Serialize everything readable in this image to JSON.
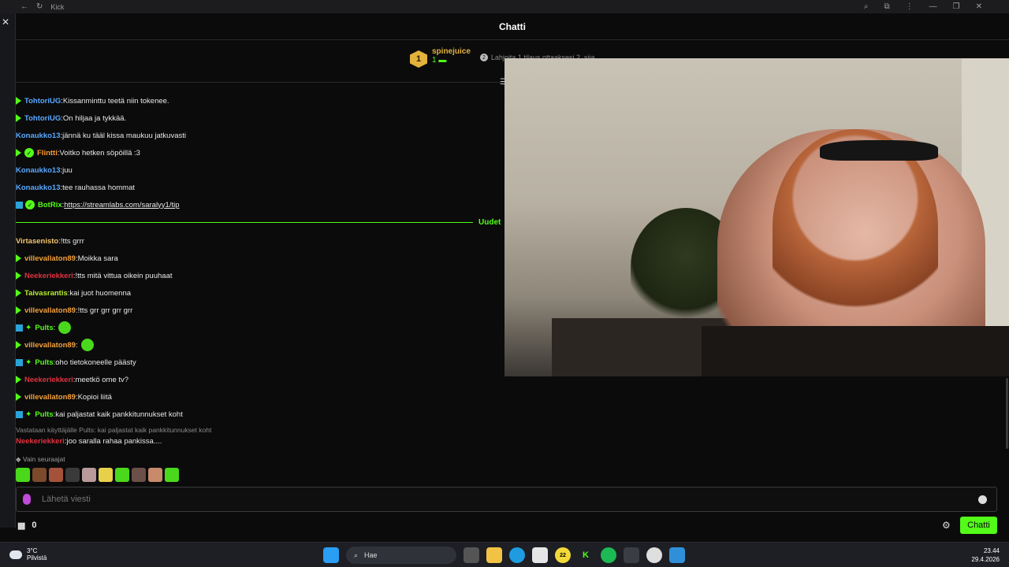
{
  "browser": {
    "title": "Kick"
  },
  "chat": {
    "header_title": "Chatti",
    "pinned": {
      "rank": "1",
      "user": "spinejuice",
      "count": "1",
      "gift_text": "Lahjoita 1 tilaus ottaaksesi 2. sija"
    },
    "new_label": "Uudet",
    "messages": [
      {
        "user": "TohtoriUG",
        "color": "#5aa9ff",
        "badge": "tri",
        "text": "Kissanminttu teetä niin tokenee."
      },
      {
        "user": "TohtoriUG",
        "color": "#5aa9ff",
        "badge": "tri",
        "text": "On hiljaa ja tykkää."
      },
      {
        "user": "Konaukko13",
        "color": "#5aa9ff",
        "badge": "",
        "text": "jännä ku tääl kissa maukuu jatkuvasti"
      },
      {
        "user": "Flintti",
        "color": "#ff9a2e",
        "badge": "tri-verify",
        "text": "Voitko hetken söpöillä :3"
      },
      {
        "user": "Konaukko13",
        "color": "#5aa9ff",
        "badge": "",
        "text": "juu"
      },
      {
        "user": "Konaukko13",
        "color": "#5aa9ff",
        "badge": "",
        "text": "tee rauhassa hommat"
      },
      {
        "user": "BotRix",
        "color": "#53fc18",
        "badge": "sq-verify",
        "text": "https://streamlabs.com/saralyy1/tip",
        "link": true
      },
      {
        "user": "Virtasenisto",
        "color": "#f4c46b",
        "badge": "",
        "text": "!tts grrr"
      },
      {
        "user": "villevallaton89",
        "color": "#f4a13b",
        "badge": "tri",
        "text": "Moikka sara"
      },
      {
        "user": "Neekeriekkeri",
        "color": "#e0323f",
        "badge": "tri",
        "text": "!tts mitä vittua oikein puuhaat"
      },
      {
        "user": "Taivasrantis",
        "color": "#b8f02e",
        "badge": "tri",
        "text": "kai juot huomenna"
      },
      {
        "user": "villevallaton89",
        "color": "#f4a13b",
        "badge": "tri",
        "text": "!tts grr grr grr grr"
      },
      {
        "user": "Pults",
        "color": "#53fc18",
        "badge": "sq-star",
        "text": "",
        "emote": true
      },
      {
        "user": "villevallaton89",
        "color": "#f4a13b",
        "badge": "tri",
        "text": "",
        "emote": true
      },
      {
        "user": "Pults",
        "color": "#53fc18",
        "badge": "sq-star",
        "text": "oho tietokoneelle päästy"
      },
      {
        "user": "Neekeriekkeri",
        "color": "#e0323f",
        "badge": "tri",
        "text": "meetkö ome tv?"
      },
      {
        "user": "villevallaton89",
        "color": "#f4a13b",
        "badge": "tri",
        "text": "Kopioi liitä"
      },
      {
        "user": "Pults",
        "color": "#53fc18",
        "badge": "sq-star",
        "text": "kai paljastat kaik pankkitunnukset koht"
      },
      {
        "user": "Neekeriekkeri",
        "color": "#e0323f",
        "badge": "",
        "text": "joo saralla rahaa pankissa...."
      }
    ],
    "reply_context": "Vastataan käyttäjälle Pults: kai paljastat kaik pankkitunnukset koht",
    "followers_only": "Vain seuraajat",
    "input_placeholder": "Lähetä viesti",
    "points": "0",
    "send_label": "Chatti"
  },
  "taskbar": {
    "weather_temp": "3°C",
    "weather_desc": "Pilvistä",
    "search_label": "Hae",
    "notif_count": "22",
    "time": "23.44",
    "date": "29.4.2026"
  }
}
